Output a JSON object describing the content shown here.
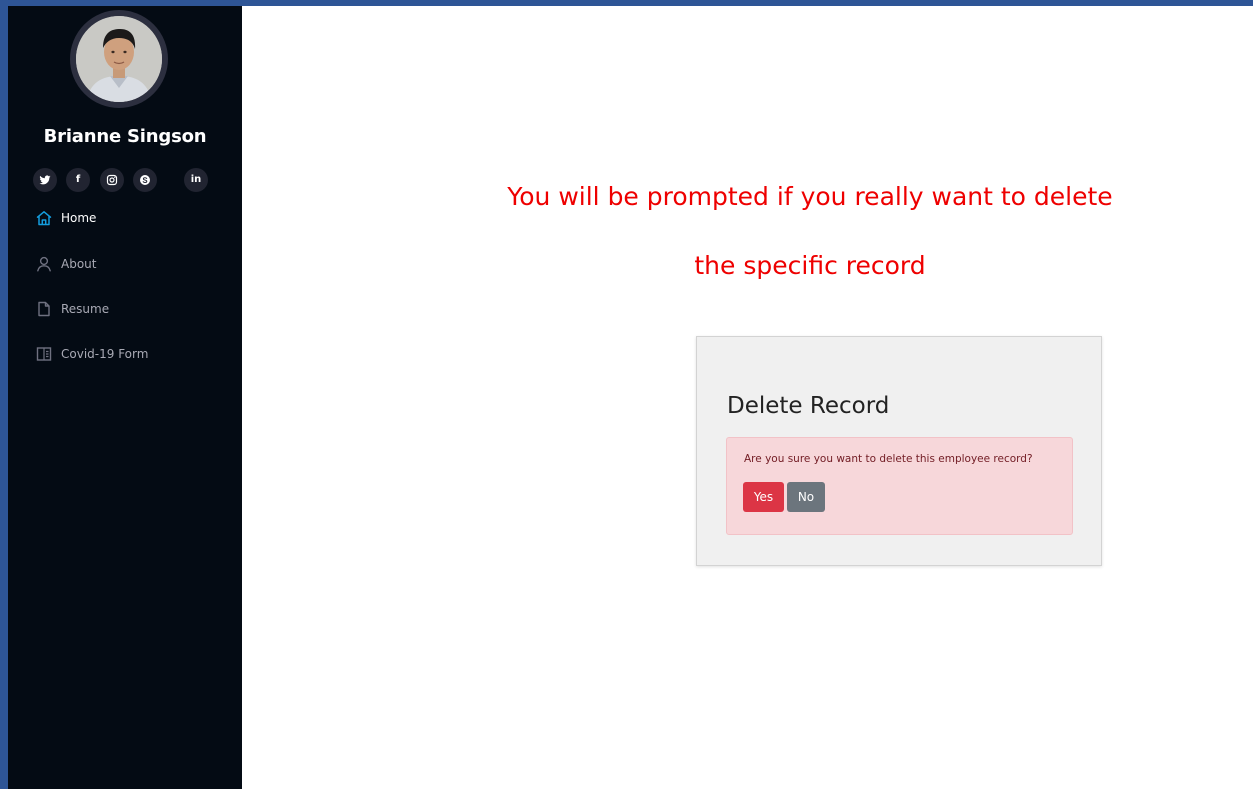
{
  "sidebar": {
    "profile_name": "Brianne Singson",
    "social": [
      {
        "icon": "twitter-icon",
        "glyph": ""
      },
      {
        "icon": "facebook-icon",
        "glyph": "f"
      },
      {
        "icon": "instagram-icon",
        "glyph": ""
      },
      {
        "icon": "skype-icon",
        "glyph": ""
      },
      {
        "icon": "linkedin-icon",
        "glyph": "in"
      }
    ],
    "nav": [
      {
        "label": "Home",
        "icon": "home-icon",
        "active": true
      },
      {
        "label": "About",
        "icon": "person-icon",
        "active": false
      },
      {
        "label": "Resume",
        "icon": "file-icon",
        "active": false
      },
      {
        "label": "Covid-19 Form",
        "icon": "form-icon",
        "active": false
      }
    ]
  },
  "annotation": {
    "line1": "You will be prompted if you really want to delete",
    "line2": "the specific record"
  },
  "dialog": {
    "title": "Delete Record",
    "message": "Are you sure you want to delete this employee record?",
    "yes_label": "Yes",
    "no_label": "No"
  },
  "colors": {
    "sidebar_bg": "#040b14",
    "accent": "#149ddd",
    "annotation": "#ee0000",
    "danger": "#dc3545",
    "secondary": "#6c757d",
    "alert_bg": "#f7d7da",
    "frame_border": "#2e5596"
  }
}
